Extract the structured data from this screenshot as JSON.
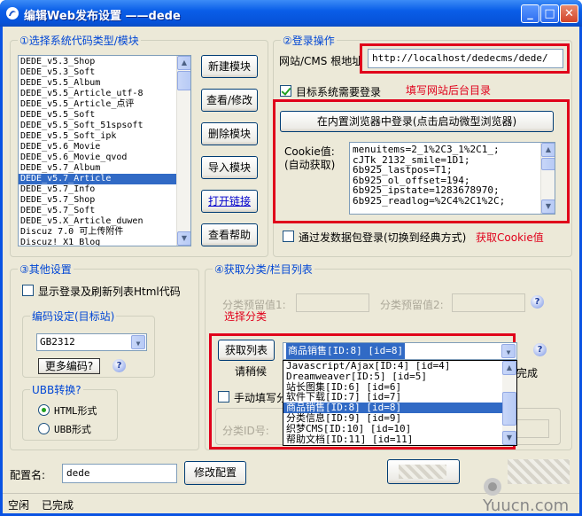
{
  "window": {
    "title": "编辑Web发布设置 ——dede",
    "controls": {
      "minimize": "_",
      "maximize": "□",
      "close": "✕"
    }
  },
  "groups": {
    "code_type": "①选择系统代码类型/模块",
    "login": "②登录操作",
    "other": "③其他设置",
    "categories": "④获取分类/栏目列表",
    "encoding": "编码设定(目标站)",
    "ubb": "UBB转换?"
  },
  "modules": {
    "items": [
      "DEDE_v5.3_Shop",
      "DEDE_v5.3_Soft",
      "DEDE_v5.5_Album",
      "DEDE_v5.5_Article_utf-8",
      "DEDE_v5.5_Article_点评",
      "DEDE_v5.5_Soft",
      "DEDE_v5.5_Soft_51spsoft",
      "DEDE_v5.5_Soft_ipk",
      "DEDE_v5.6_Movie",
      "DEDE_v5.6_Movie_qvod",
      "DEDE_v5.7_Album",
      "DEDE_v5.7_Article",
      "DEDE_v5.7_Info",
      "DEDE_v5.7_Shop",
      "DEDE_v5.7_Soft",
      "DEDE_v5.X_Article_duwen",
      "Discuz 7.0 可上传附件",
      "Discuz! X1_Blog"
    ],
    "selected": 11
  },
  "module_buttons": {
    "new": "新建模块",
    "edit": "查看/修改",
    "delete": "删除模块",
    "import": "导入模块",
    "open_link": "打开链接",
    "help": "查看帮助"
  },
  "login": {
    "url_label": "网站/CMS 根地址",
    "url_value": "http://localhost/dedecms/dede/",
    "need_login_label": "目标系统需要登录",
    "need_login_checked": true,
    "note_url": "填写网站后台目录",
    "browser_button": "在内置浏览器中登录(点击启动微型浏览器)",
    "cookie_label": "Cookie值:",
    "cookie_sub": "(自动获取)",
    "cookie_lines": [
      "menuitems=2_1%2C3_1%2C1_;",
      "cJTk_2132_smile=1D1;",
      "6b925_lastpos=T1;",
      "6b925_ol_offset=194;",
      "6b925_ipstate=1283678970;",
      "6b925_readlog=%2C4%2C1%2C;"
    ],
    "packet_login_label": "通过发数据包登录(切换到经典方式)",
    "packet_login_checked": false,
    "note_cookie": "获取Cookie值"
  },
  "other": {
    "show_login_label": "显示登录及刷新列表Html代码",
    "show_login_checked": false,
    "encoding_value": "GB2312",
    "more_encoding": "更多编码?",
    "ubb_html": "HTML形式",
    "ubb_ubb": "UBB形式",
    "ubb_selected": "html"
  },
  "categories": {
    "reserve1_label": "分类预留值1:",
    "reserve2_label": "分类预留值2:",
    "note": "选择分类",
    "fetch_button": "获取列表",
    "wait_label": "请稍候",
    "done_label": "完成",
    "manual_label": "手动填写分",
    "category_id_label": "分类ID号:",
    "selected_value": "商品销售[ID:8]   [id=8]",
    "options": [
      "Javascript/Ajax[ID:4]   [id=4]",
      "Dreamweaver[ID:5]   [id=5]",
      "站长图集[ID:6]   [id=6]",
      "软件下载[ID:7]   [id=7]",
      "商品销售[ID:8]   [id=8]",
      "分类信息[ID:9]   [id=9]",
      "织梦CMS[ID:10]   [id=10]",
      "帮助文档[ID:11]   [id=11]"
    ],
    "selected_index": 4
  },
  "config": {
    "name_label": "配置名:",
    "name_value": "dede",
    "modify_button": "修改配置"
  },
  "status": {
    "left": "空闲",
    "right": "已完成"
  },
  "watermark": "Yuucn.com",
  "colors": {
    "title_blue": "#0a5ee8",
    "face": "#ece9d8",
    "group_label": "#0046d5",
    "annotation_red": "#e0001b",
    "selection": "#316ac5"
  }
}
